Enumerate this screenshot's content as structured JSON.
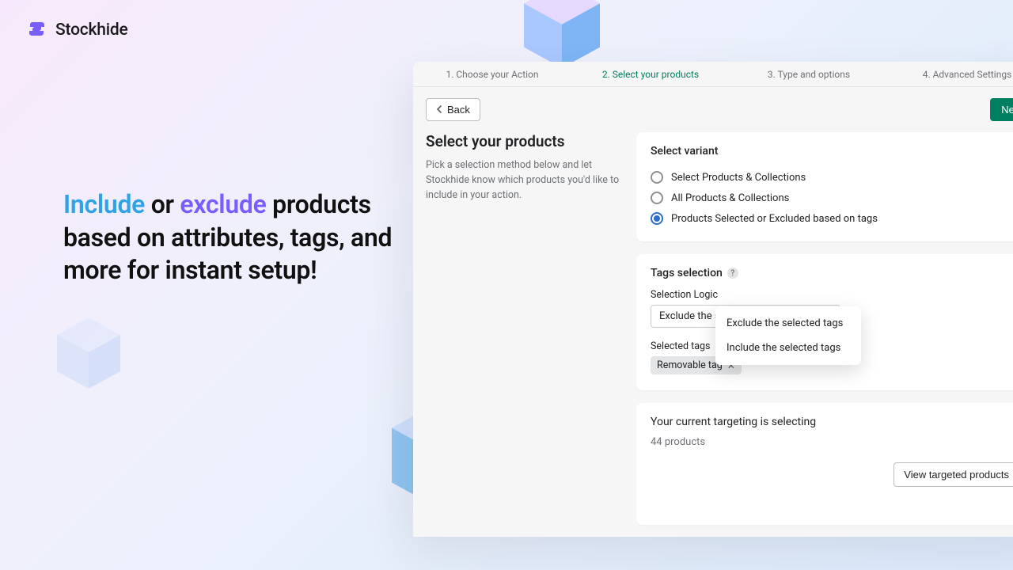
{
  "logo": {
    "text": "Stockhide"
  },
  "headline": {
    "include": "Include",
    "mid1": " or ",
    "exclude": "exclude",
    "rest": " products based on attributes, tags, and more for instant setup!"
  },
  "stepper": {
    "s1": "1. Choose your Action",
    "s2": "2. Select your products",
    "s3": "3. Type and options",
    "s4": "4. Advanced Settings"
  },
  "toolbar": {
    "back": "Back",
    "next": "Next"
  },
  "left": {
    "title": "Select your products",
    "desc": "Pick a selection method below and let Stockhide know which products you'd like to include in your action."
  },
  "variant": {
    "title": "Select variant",
    "opt1": "Select Products & Collections",
    "opt2": "All Products & Collections",
    "opt3": "Products Selected or Excluded based on tags"
  },
  "tags": {
    "title": "Tags selection",
    "logic_label": "Selection Logic",
    "select_value": "Exclude the selected tags",
    "dropdown": {
      "o1": "Exclude the selected tags",
      "o2": "Include the selected tags"
    },
    "selected_label": "Selected tags",
    "chip": "Removable tag"
  },
  "targeting": {
    "title": "Your current targeting is selecting",
    "count": "44 products",
    "view": "View targeted products"
  }
}
